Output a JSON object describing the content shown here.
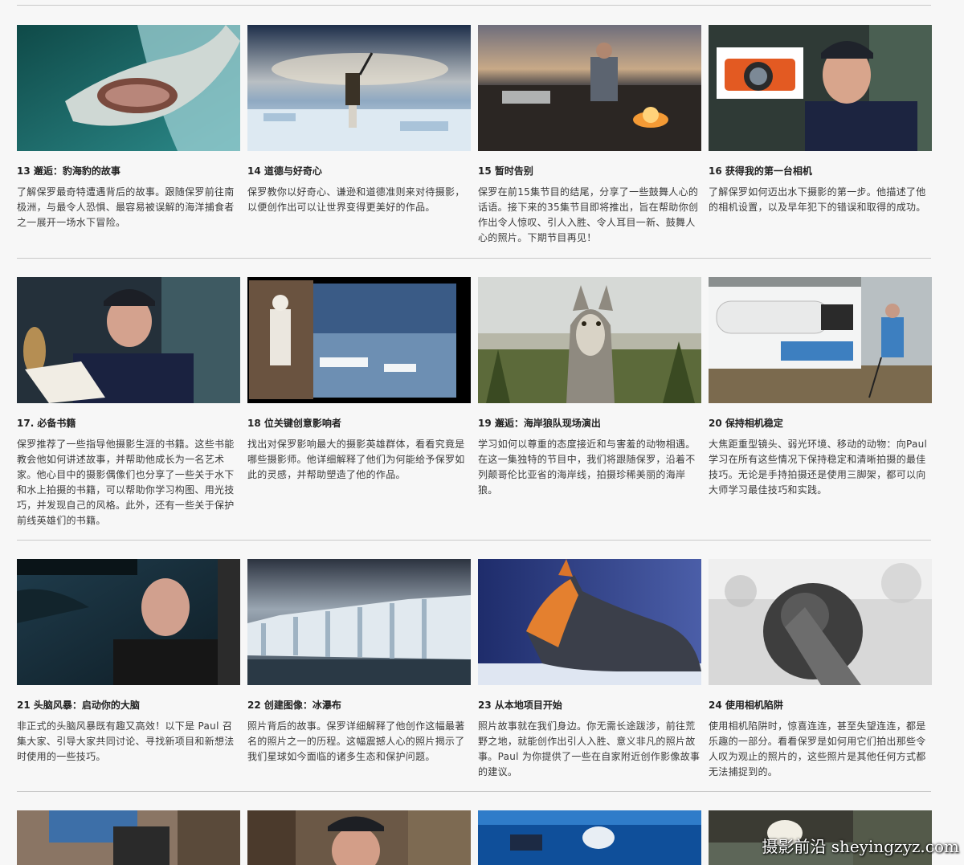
{
  "rows": [
    {
      "cards": [
        {
          "title": "13 邂逅：豹海豹的故事",
          "desc": "了解保罗最奇特遭遇背后的故事。跟随保罗前往南极洲，与最令人恐惧、最容易被误解的海洋捕食者之一展开一场水下冒险。"
        },
        {
          "title": "14 道德与好奇心",
          "desc": "保罗教你以好奇心、谦逊和道德准则来对待摄影，以便创作出可以让世界变得更美好的作品。"
        },
        {
          "title": "15 暂时告别",
          "desc": "保罗在前15集节目的结尾，分享了一些鼓舞人心的话语。接下来的35集节目即将推出，旨在帮助你创作出令人惊叹、引人入胜、令人耳目一新、鼓舞人心的照片。下期节目再见！"
        },
        {
          "title": "16 获得我的第一台相机",
          "desc": "了解保罗如何迈出水下摄影的第一步。他描述了他的相机设置，以及早年犯下的错误和取得的成功。"
        }
      ]
    },
    {
      "cards": [
        {
          "title": "17. 必备书籍",
          "desc": "保罗推荐了一些指导他摄影生涯的书籍。这些书能教会他如何讲述故事，并帮助他成长为一名艺术家。他心目中的摄影偶像们也分享了一些关于水下和水上拍摄的书籍，可以帮助你学习构图、用光技巧，并发现自己的风格。此外，还有一些关于保护前线英雄们的书籍。"
        },
        {
          "title": "18 位关键创意影响者",
          "desc": "找出对保罗影响最大的摄影英雄群体，看看究竟是哪些摄影师。他详细解释了他们为何能给予保罗如此的灵感，并帮助塑造了他的作品。"
        },
        {
          "title": "19 邂逅：海岸狼队现场演出",
          "desc": "学习如何以尊重的态度接近和与害羞的动物相遇。在这一集独特的节目中，我们将跟随保罗，沿着不列颠哥伦比亚省的海岸线，拍摄珍稀美丽的海岸狼。"
        },
        {
          "title": "20 保持相机稳定",
          "desc": "大焦距重型镜头、弱光环境、移动的动物：向Paul学习在所有这些情况下保持稳定和清晰拍摄的最佳技巧。无论是手持拍摄还是使用三脚架，都可以向大师学习最佳技巧和实践。"
        }
      ]
    },
    {
      "cards": [
        {
          "title": "21 头脑风暴：启动你的大脑",
          "desc": "非正式的头脑风暴既有趣又高效！以下是 Paul 召集大家、引导大家共同讨论、寻找新项目和新想法时使用的一些技巧。"
        },
        {
          "title": "22 创建图像：冰瀑布",
          "desc": "照片背后的故事。保罗详细解释了他创作这幅最著名的照片之一的历程。这幅震撼人心的照片揭示了我们星球如今面临的诸多生态和保护问题。"
        },
        {
          "title": "23 从本地项目开始",
          "desc": "照片故事就在我们身边。你无需长途跋涉，前往荒野之地，就能创作出引人入胜、意义非凡的照片故事。Paul 为你提供了一些在自家附近创作影像故事的建议。"
        },
        {
          "title": "24 使用相机陷阱",
          "desc": "使用相机陷阱时，惊喜连连，甚至失望连连，都是乐趣的一部分。看看保罗是如何用它们拍出那些令人叹为观止的照片的，这些照片是其他任何方式都无法捕捉到的。"
        }
      ]
    }
  ],
  "watermark": "摄影前沿 sheyingzyz.com"
}
